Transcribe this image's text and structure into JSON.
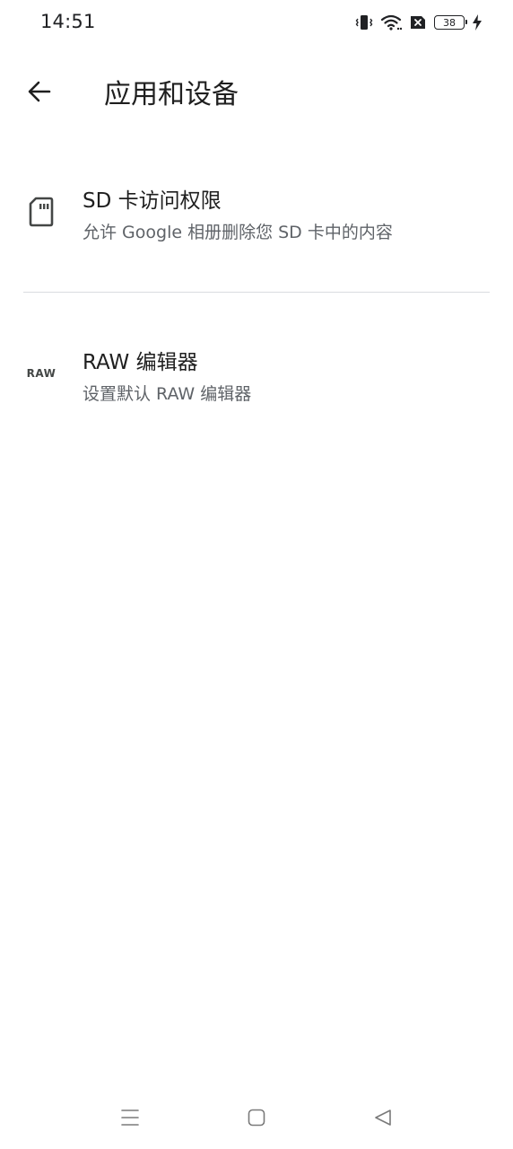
{
  "status_bar": {
    "time": "14:51",
    "battery_level": "38",
    "icons": [
      "vibrate-icon",
      "wifi-icon",
      "no-sim-icon",
      "battery-icon",
      "charging-icon"
    ]
  },
  "app_bar": {
    "title": "应用和设备",
    "back_icon": "arrow-back-icon"
  },
  "list": {
    "items": [
      {
        "icon": "sd-card-icon",
        "title": "SD 卡访问权限",
        "subtitle": "允许 Google 相册删除您 SD 卡中的内容"
      },
      {
        "icon": "raw-icon",
        "icon_text": "RAW",
        "title": "RAW 编辑器",
        "subtitle": "设置默认 RAW 编辑器"
      }
    ]
  },
  "nav_bar": {
    "icons": [
      "menu-icon",
      "home-icon",
      "back-triangle-icon"
    ]
  },
  "colors": {
    "text_primary": "#1f1f1f",
    "text_secondary": "#5f6368",
    "divider": "#dadce0",
    "icon": "#444746"
  }
}
